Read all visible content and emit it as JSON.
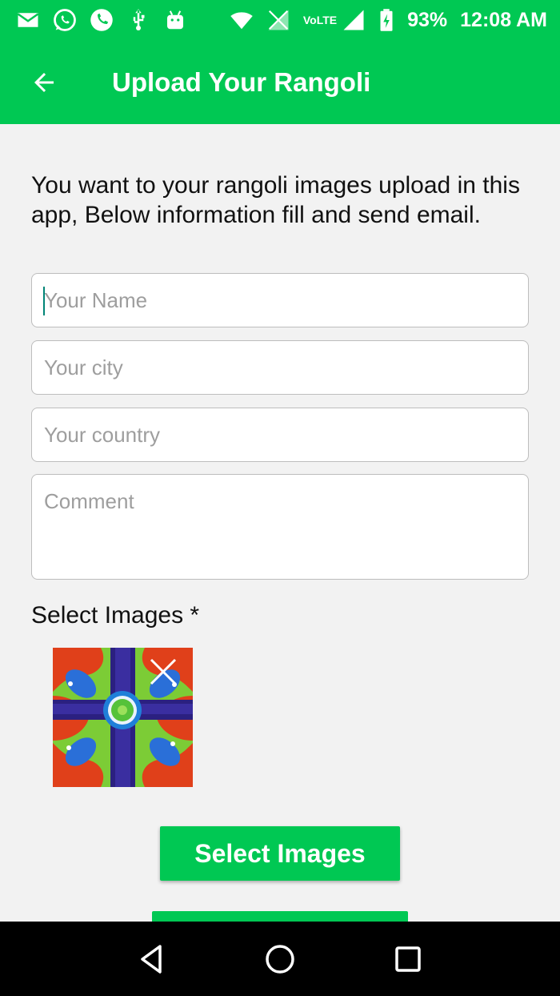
{
  "status_bar": {
    "battery": "93%",
    "time": "12:08 AM",
    "network": "VoLTE",
    "icons_left": [
      "mail-icon",
      "whatsapp-icon",
      "phone-icon",
      "usb-icon",
      "android-icon"
    ],
    "icons_right": [
      "wifi-icon",
      "signal-off-icon",
      "signal-icon",
      "battery-charging-icon"
    ]
  },
  "app_bar": {
    "title": "Upload Your Rangoli",
    "back_icon": "arrow-back-icon"
  },
  "intro_text": "You want to your rangoli images upload in this app, Below information fill and send email.",
  "form": {
    "name_placeholder": "Your Name",
    "city_placeholder": "Your city",
    "country_placeholder": "Your country",
    "comment_placeholder": "Comment",
    "name_value": "",
    "city_value": "",
    "country_value": "",
    "comment_value": ""
  },
  "images": {
    "label": "Select Images *",
    "selected_count": 1
  },
  "buttons": {
    "select_images": "Select Images"
  },
  "nav_bar": {
    "icons": [
      "back-triangle-icon",
      "home-circle-icon",
      "recents-square-icon"
    ]
  },
  "colors": {
    "primary": "#00c853",
    "background": "#f2f2f2",
    "nav_background": "#000000"
  }
}
